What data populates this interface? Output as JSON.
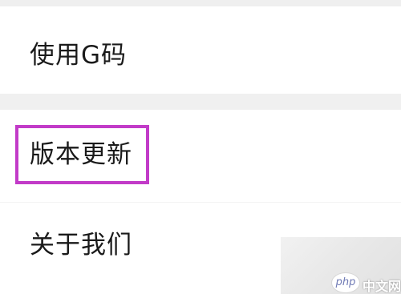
{
  "settings_list": {
    "items": [
      {
        "label": "使用G码"
      },
      {
        "label": "版本更新"
      },
      {
        "label": "关于我们"
      }
    ]
  },
  "highlight": {
    "color": "#c23bc8",
    "target_label": "版本更新"
  },
  "watermark": {
    "logo_text": "php",
    "site_text": "中文网"
  }
}
